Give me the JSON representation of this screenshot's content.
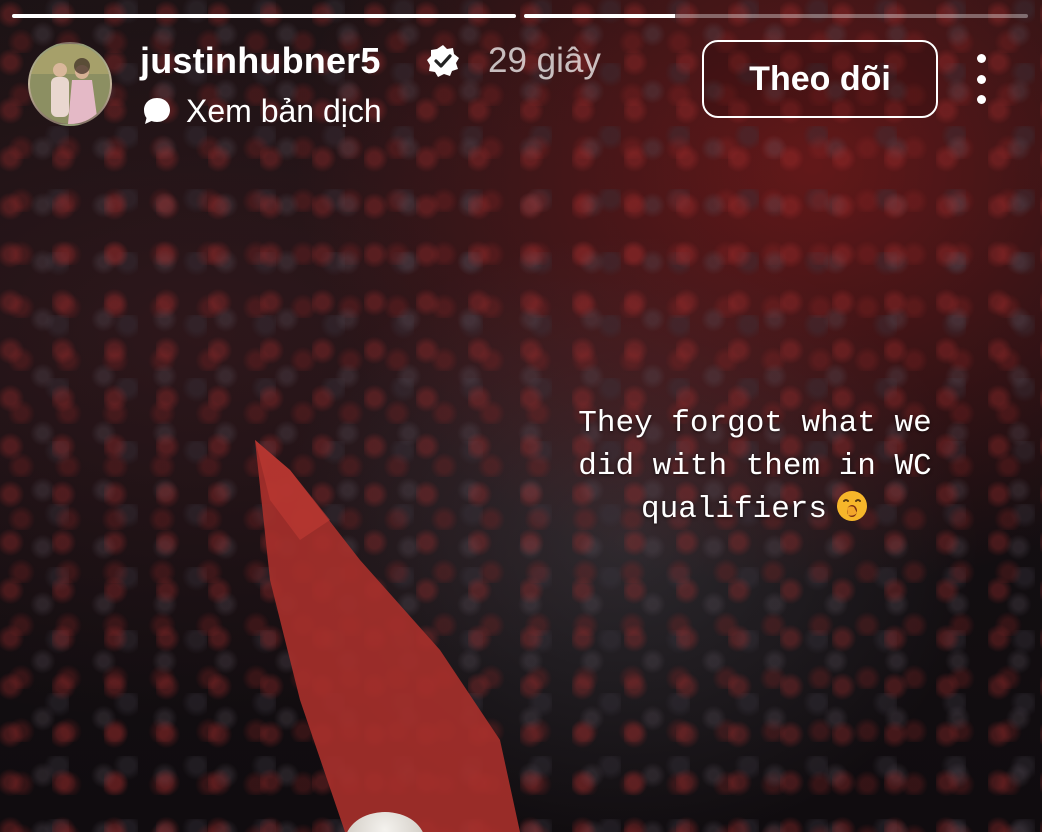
{
  "progress": {
    "segments": [
      {
        "fill": 1.0
      },
      {
        "fill": 0.3
      }
    ]
  },
  "header": {
    "username": "justinhubner5",
    "timestamp": "29 giây",
    "translate_label": "Xem bản dịch",
    "follow_label": "Theo dõi"
  },
  "caption": {
    "lines": [
      "They forgot what we",
      "did with them in WC",
      "qualifiers"
    ]
  },
  "colors": {
    "flag": "#b0302c",
    "text": "#ffffff",
    "emoji": "#f6b62a"
  },
  "icons": {
    "verified": "verified-badge-icon",
    "translate": "speech-bubble-icon",
    "more": "more-vertical-icon",
    "emoji": "yawning-face-emoji"
  }
}
